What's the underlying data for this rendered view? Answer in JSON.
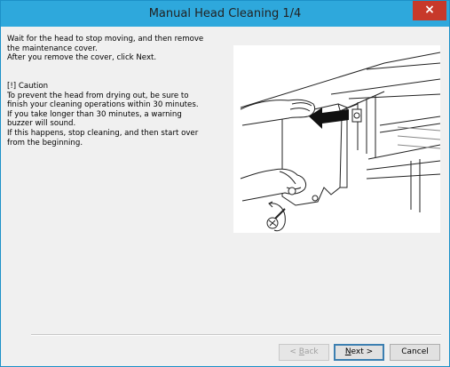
{
  "window": {
    "title": "Manual Head Cleaning 1/4",
    "close_glyph": "×"
  },
  "instructions": [
    "Wait for the head to stop moving, and then remove",
    "the maintenance cover.",
    "After you remove the cover, click Next."
  ],
  "caution": [
    "[!] Caution",
    "To prevent the head from drying out, be sure to",
    "finish your cleaning operations within 30 minutes.",
    "If you take longer than 30 minutes, a warning",
    "buzzer will sound.",
    "If this happens, stop cleaning, and then start over",
    "from the beginning."
  ],
  "buttons": {
    "back": {
      "prefix": "< ",
      "mnemonic": "B",
      "rest": "ack",
      "disabled": true
    },
    "next": {
      "mnemonic": "N",
      "rest": "ext >"
    },
    "cancel": "Cancel"
  },
  "colors": {
    "titlebar": "#2ea8dc",
    "close": "#c7392a",
    "dialog_bg": "#f0f0f0"
  },
  "illustration": "remove-maintenance-cover-illustration"
}
